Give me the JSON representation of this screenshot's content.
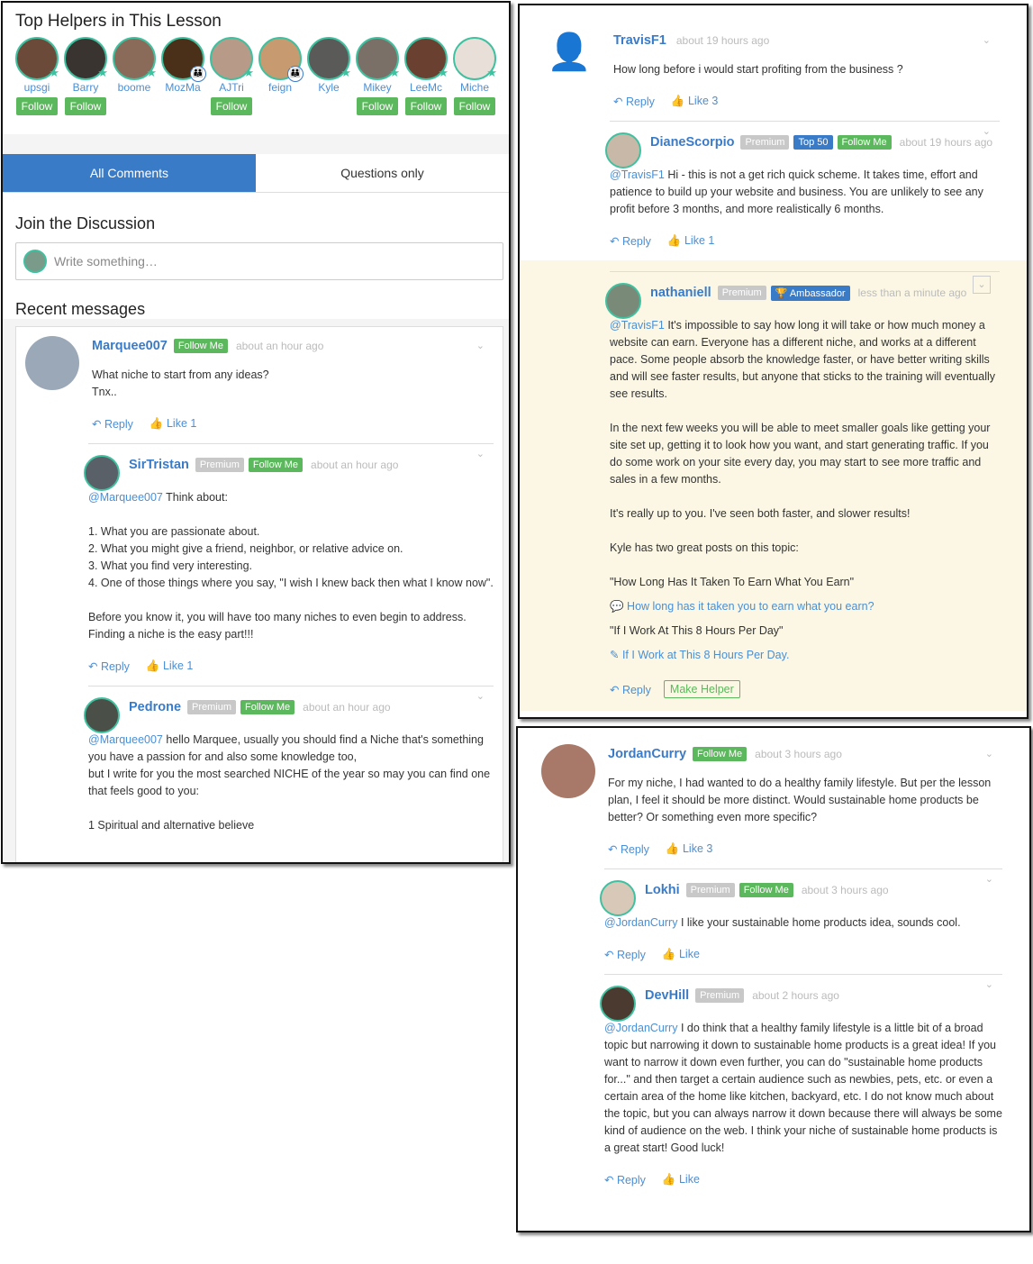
{
  "helpers_panel": {
    "title": "Top Helpers in This Lesson",
    "follow_label": "Follow",
    "helpers": [
      {
        "name": "upsgi",
        "follow": true,
        "badge": "star",
        "color": "#6b4a3a"
      },
      {
        "name": "Barry",
        "follow": true,
        "badge": "star",
        "color": "#3a3430"
      },
      {
        "name": "boome",
        "follow": false,
        "badge": "star",
        "color": "#8a6a58"
      },
      {
        "name": "MozMa",
        "follow": false,
        "badge": "family",
        "color": "#4a3018"
      },
      {
        "name": "AJTri",
        "follow": true,
        "badge": "star",
        "color": "#b89a88"
      },
      {
        "name": "feign",
        "follow": false,
        "badge": "family",
        "color": "#c89a70"
      },
      {
        "name": "Kyle",
        "follow": false,
        "badge": "star",
        "color": "#5a5a58"
      },
      {
        "name": "Mikey",
        "follow": true,
        "badge": "star",
        "color": "#7a7068"
      },
      {
        "name": "LeeMc",
        "follow": true,
        "badge": "star",
        "color": "#6a4030"
      },
      {
        "name": "Miche",
        "follow": true,
        "badge": "star",
        "color": "#e8e0d8"
      }
    ]
  },
  "tabs": [
    {
      "label": "All Comments",
      "active": true
    },
    {
      "label": "Questions only",
      "active": false
    }
  ],
  "join": {
    "title": "Join the Discussion",
    "placeholder": "Write something…"
  },
  "recent_title": "Recent messages",
  "threads": [
    {
      "panel": "p1list",
      "comments": [
        {
          "user": "Marquee007",
          "badges": [
            {
              "label": "Follow Me",
              "type": "follow"
            }
          ],
          "time": "about an hour ago",
          "color": "#9aa8b8",
          "body": [
            {
              "t": "p",
              "text": "What niche to start from any ideas?\nTnx.."
            }
          ],
          "reply": "Reply",
          "like": "Like 1"
        },
        {
          "user": "SirTristan",
          "reply_to": true,
          "badges": [
            {
              "label": "Premium",
              "type": "premium"
            },
            {
              "label": "Follow Me",
              "type": "follow"
            }
          ],
          "time": "about an hour ago",
          "color": "#5a6068",
          "body": [
            {
              "t": "p",
              "mention": "@Marquee007",
              "text": " Think about:"
            },
            {
              "t": "p",
              "text": "1. What you are passionate about.\n2. What you might give a friend, neighbor, or relative advice on.\n3. What you find very interesting.\n4. One of those things where you say, \"I wish I knew back then what I know now\"."
            },
            {
              "t": "p",
              "text": "Before you know it, you will have too many niches to even begin to address. Finding a niche is the easy part!!!"
            }
          ],
          "reply": "Reply",
          "like": "Like 1"
        },
        {
          "user": "Pedrone",
          "reply_to": true,
          "badges": [
            {
              "label": "Premium",
              "type": "premium"
            },
            {
              "label": "Follow Me",
              "type": "follow"
            }
          ],
          "time": "about an hour ago",
          "color": "#4a5048",
          "body": [
            {
              "t": "p",
              "mention": "@Marquee007",
              "text": " hello Marquee, usually you should find a Niche that's something you have a passion for and also some knowledge too,\nbut I write for you the most searched NICHE of the year so may you can find one that feels good to you:"
            },
            {
              "t": "p",
              "text": "1 Spiritual and alternative believe"
            }
          ]
        }
      ]
    },
    {
      "panel": "p2",
      "comments": [
        {
          "user": "TravisF1",
          "badges": [],
          "time": "about 19 hours ago",
          "color": "outline",
          "body": [
            {
              "t": "p",
              "text": "How long before i would start profiting from the business ?"
            }
          ],
          "reply": "Reply",
          "like": "Like 3"
        },
        {
          "user": "DianeScorpio",
          "reply_to": true,
          "badges": [
            {
              "label": "Premium",
              "type": "premium"
            },
            {
              "label": "Top 50",
              "type": "top"
            },
            {
              "label": "Follow Me",
              "type": "follow"
            }
          ],
          "time": "about 19 hours ago",
          "color": "#c8b8a8",
          "body": [
            {
              "t": "p",
              "mention": "@TravisF1",
              "text": " Hi - this is not a get rich quick scheme. It takes time, effort and patience to build up your website and business. You are unlikely to see any profit before 3 months, and more realistically 6 months."
            }
          ],
          "reply": "Reply",
          "like": "Like 1"
        },
        {
          "user": "nathaniell",
          "reply_to": true,
          "highlight": true,
          "boxchev": true,
          "badges": [
            {
              "label": "Premium",
              "type": "premium"
            },
            {
              "label": "🏆 Ambassador",
              "type": "amb"
            }
          ],
          "time": "less than a minute ago",
          "color": "#7a8a78",
          "body": [
            {
              "t": "p",
              "mention": "@TravisF1",
              "text": " It's impossible to say how long it will take or how much money a website can earn. Everyone has a different niche, and works at a different pace. Some people absorb the knowledge faster, or have better writing skills and will see faster results, but anyone that sticks to the training will eventually see results."
            },
            {
              "t": "p",
              "text": "In the next few weeks you will be able to meet smaller goals like getting your site set up, getting it to look how you want, and start generating traffic. If you do some work on your site every day, you may start to see more traffic and sales in a few months."
            },
            {
              "t": "p",
              "text": "It's really up to you. I've seen both faster, and slower results!"
            },
            {
              "t": "p",
              "text": "Kyle has two great posts on this topic:"
            },
            {
              "t": "q",
              "text": "\"How Long Has It Taken To Earn What You Earn\""
            },
            {
              "t": "link",
              "icon": "💬",
              "text": "How long has it taken you to earn what you earn?"
            },
            {
              "t": "q",
              "text": "\"If I Work At This 8 Hours Per Day\""
            },
            {
              "t": "link",
              "icon": "✎",
              "text": "If I Work at This 8 Hours Per Day."
            }
          ],
          "reply": "Reply",
          "make_helper": "Make Helper"
        }
      ]
    },
    {
      "panel": "p3",
      "comments": [
        {
          "user": "JordanCurry",
          "badges": [
            {
              "label": "Follow Me",
              "type": "follow"
            }
          ],
          "time": "about 3 hours ago",
          "color": "#a87868",
          "body": [
            {
              "t": "p",
              "text": "For my niche, I had wanted to do a healthy family lifestyle. But per the lesson plan, I feel it should be more distinct. Would sustainable home products be better? Or something even more specific?"
            }
          ],
          "reply": "Reply",
          "like": "Like 3"
        },
        {
          "user": "Lokhi",
          "reply_to": true,
          "badges": [
            {
              "label": "Premium",
              "type": "premium"
            },
            {
              "label": "Follow Me",
              "type": "follow"
            }
          ],
          "time": "about 3 hours ago",
          "color": "#d8c8b8",
          "body": [
            {
              "t": "p",
              "mention": "@JordanCurry",
              "text": " I like your sustainable home products idea, sounds cool."
            }
          ],
          "reply": "Reply",
          "like": "Like"
        },
        {
          "user": "DevHill",
          "reply_to": true,
          "badges": [
            {
              "label": "Premium",
              "type": "premium"
            }
          ],
          "time": "about 2 hours ago",
          "color": "#4a3a30",
          "body": [
            {
              "t": "p",
              "mention": "@JordanCurry",
              "text": " I do think that a healthy family lifestyle is a little bit of a broad topic but narrowing it down to sustainable home products is a great idea! If you want to narrow it down even further, you can do \"sustainable home products for...\" and then target a certain audience such as newbies, pets, etc. or even a certain area of the home like kitchen, backyard, etc. I do not know much about the topic, but you can always narrow it down because there will always be some kind of audience on the web. I think your niche of sustainable home products is a great start! Good luck!"
            }
          ],
          "reply": "Reply",
          "like": "Like"
        }
      ]
    }
  ],
  "colors": {
    "accent": "#3a7bc8",
    "follow": "#5cb85c",
    "teal": "#3fc1a0",
    "highlight": "#fbf7e4"
  }
}
